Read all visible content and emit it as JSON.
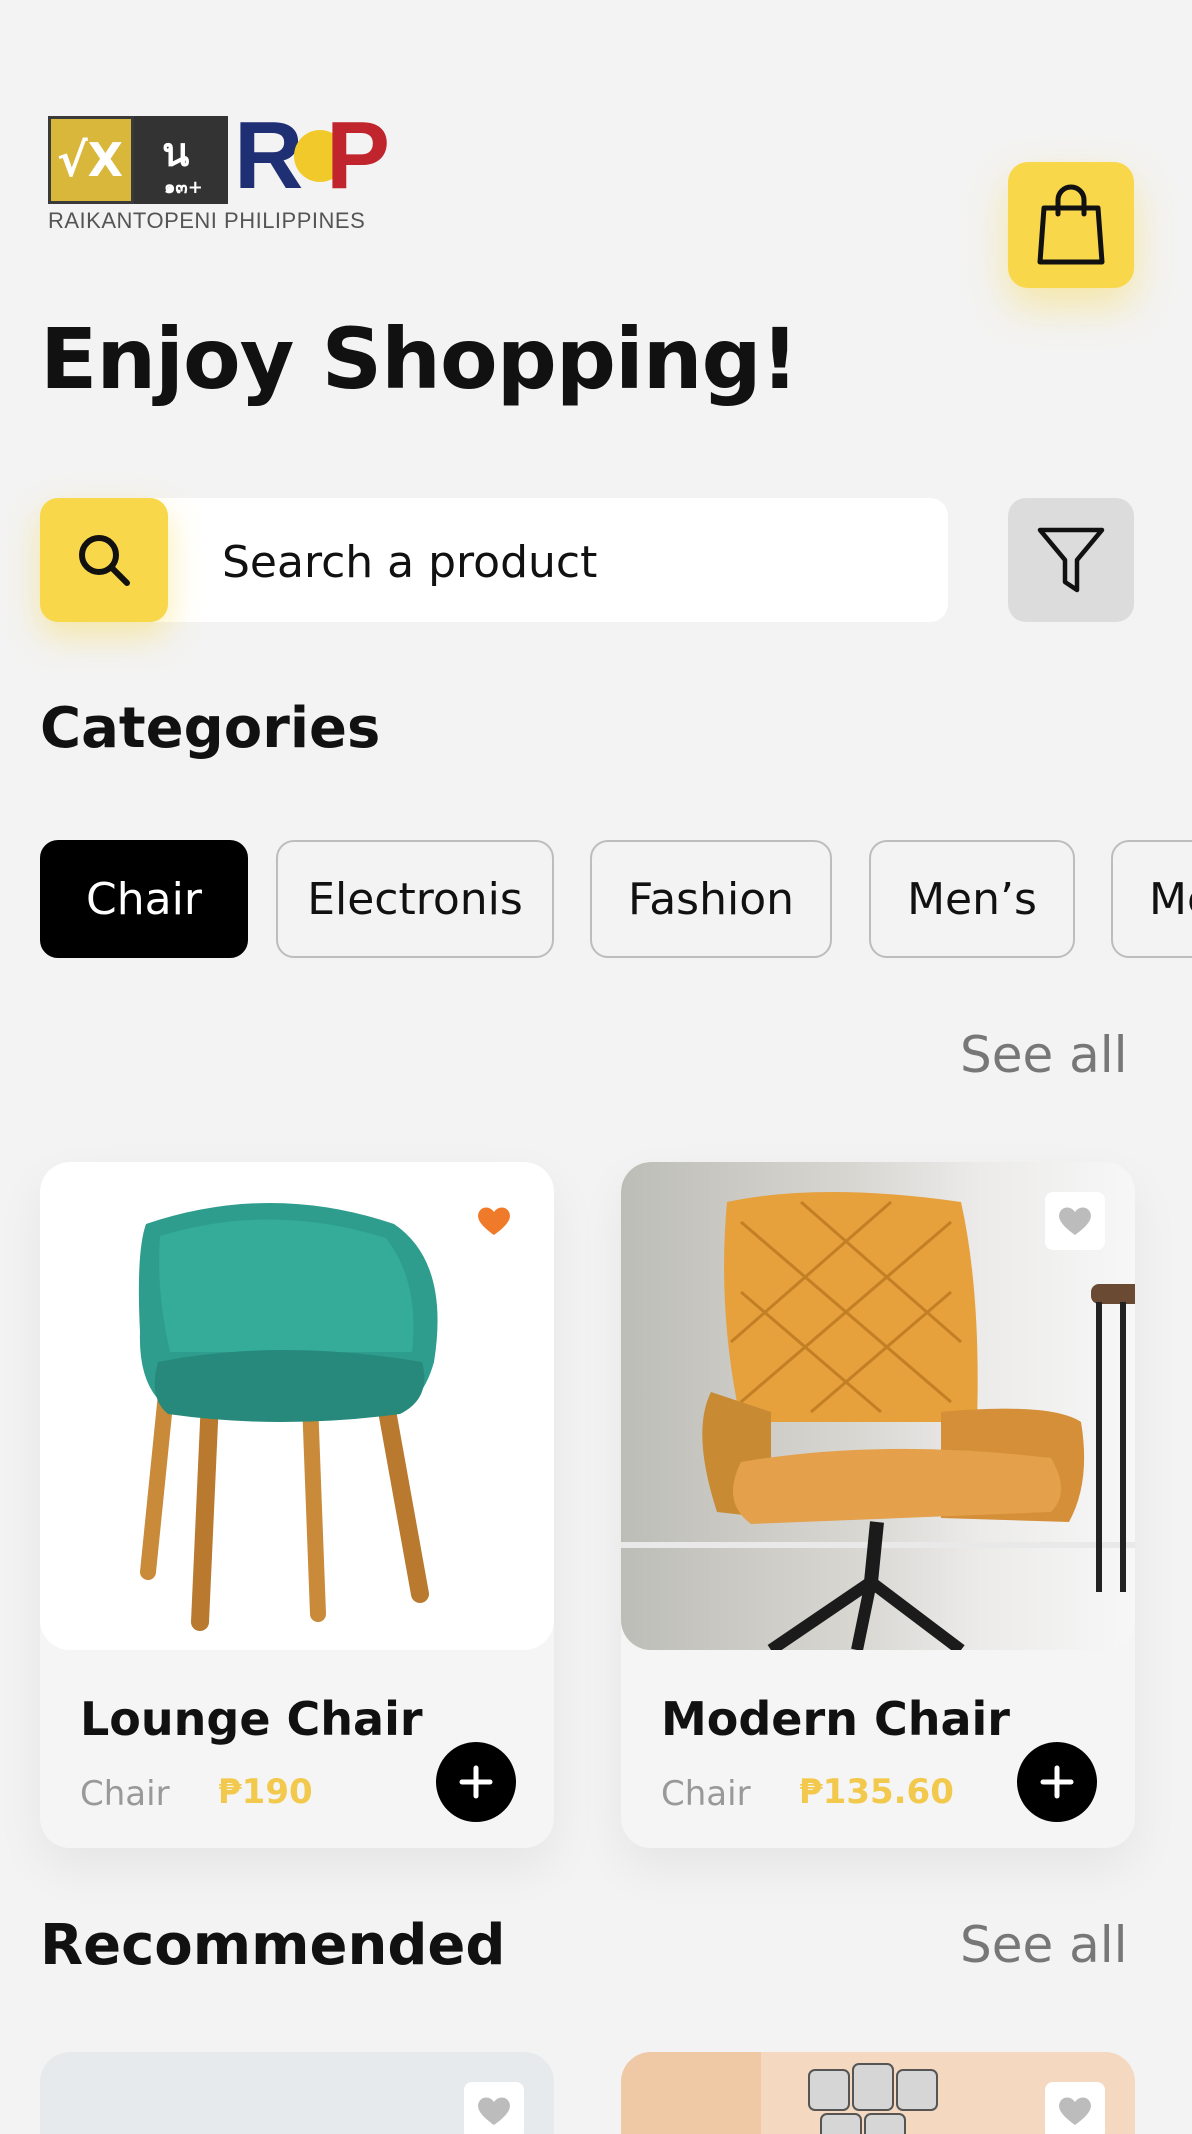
{
  "logo": {
    "tile1": "√X",
    "tile2_top": "น",
    "tile2_bottom": "๑๓+",
    "letter_r": "R",
    "letter_p": "P",
    "caption": "RAIKANTOPENI PHILIPPINES"
  },
  "header": {
    "headline": "Enjoy Shopping!",
    "cart_icon": "shopping-bag-icon"
  },
  "search": {
    "placeholder": "Search a product",
    "search_icon": "search-icon",
    "filter_icon": "filter-icon"
  },
  "categories": {
    "title": "Categories",
    "items": [
      "Chair",
      "Electronis",
      "Fashion",
      "Men’s",
      "Me"
    ],
    "active_index": 0,
    "see_all": "See all"
  },
  "products": [
    {
      "name": "Lounge Chair",
      "category": "Chair",
      "price": "₱190",
      "favorite": true
    },
    {
      "name": "Modern Chair",
      "category": "Chair",
      "price": "₱135.60",
      "favorite": false
    }
  ],
  "recommended": {
    "title": "Recommended",
    "see_all": "See all"
  },
  "colors": {
    "accent_yellow": "#f8d74a",
    "price_yellow": "#f2c94c",
    "favorite_orange": "#ee7a2a",
    "favorite_grey": "#bcbcbc",
    "background": "#f3f3f3"
  }
}
